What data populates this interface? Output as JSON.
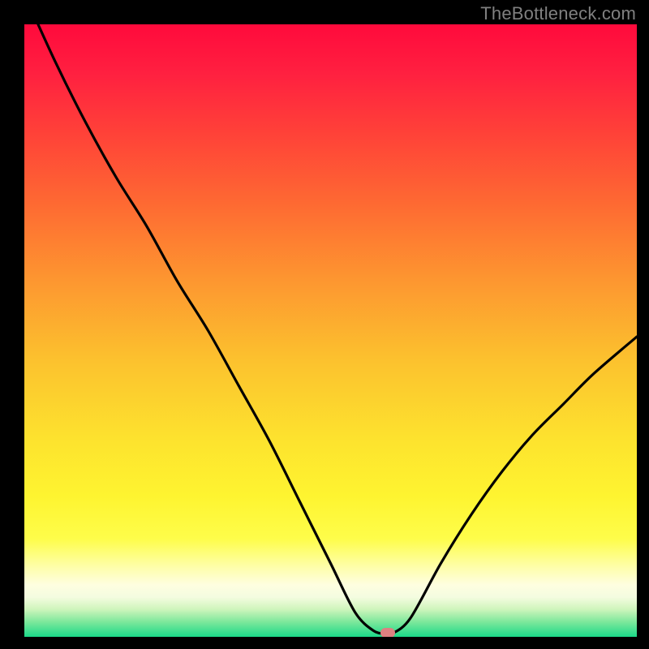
{
  "watermark": {
    "text": "TheBottleneck.com"
  },
  "chart_data": {
    "type": "line",
    "title": "",
    "xlabel": "",
    "ylabel": "",
    "xlim": [
      0,
      100
    ],
    "ylim": [
      0,
      100
    ],
    "series": [
      {
        "name": "bottleneck-curve",
        "x": [
          0,
          5,
          10,
          15,
          20,
          25,
          30,
          35,
          40,
          45,
          50,
          54,
          57,
          59,
          60,
          63,
          68,
          73,
          78,
          83,
          88,
          93,
          100
        ],
        "values": [
          105,
          94,
          84,
          75,
          67,
          58,
          50,
          41,
          32,
          22,
          12,
          4,
          1,
          0.5,
          0.5,
          3,
          12,
          20,
          27,
          33,
          38,
          43,
          49
        ]
      }
    ],
    "marker": {
      "x": 59.3,
      "y": 0.6,
      "color": "#DE8181"
    },
    "gradient_stops": [
      {
        "offset": 0.0,
        "color": "#FF0A3C"
      },
      {
        "offset": 0.08,
        "color": "#FF2040"
      },
      {
        "offset": 0.18,
        "color": "#FF4238"
      },
      {
        "offset": 0.3,
        "color": "#FE6C32"
      },
      {
        "offset": 0.42,
        "color": "#FD9730"
      },
      {
        "offset": 0.55,
        "color": "#FCC22E"
      },
      {
        "offset": 0.68,
        "color": "#FDE32E"
      },
      {
        "offset": 0.77,
        "color": "#FEF430"
      },
      {
        "offset": 0.84,
        "color": "#FEFD4A"
      },
      {
        "offset": 0.885,
        "color": "#FEFEA8"
      },
      {
        "offset": 0.915,
        "color": "#FEFEE0"
      },
      {
        "offset": 0.935,
        "color": "#F4FCE0"
      },
      {
        "offset": 0.955,
        "color": "#CFF5BC"
      },
      {
        "offset": 0.975,
        "color": "#7FE89C"
      },
      {
        "offset": 1.0,
        "color": "#1BD989"
      }
    ]
  }
}
